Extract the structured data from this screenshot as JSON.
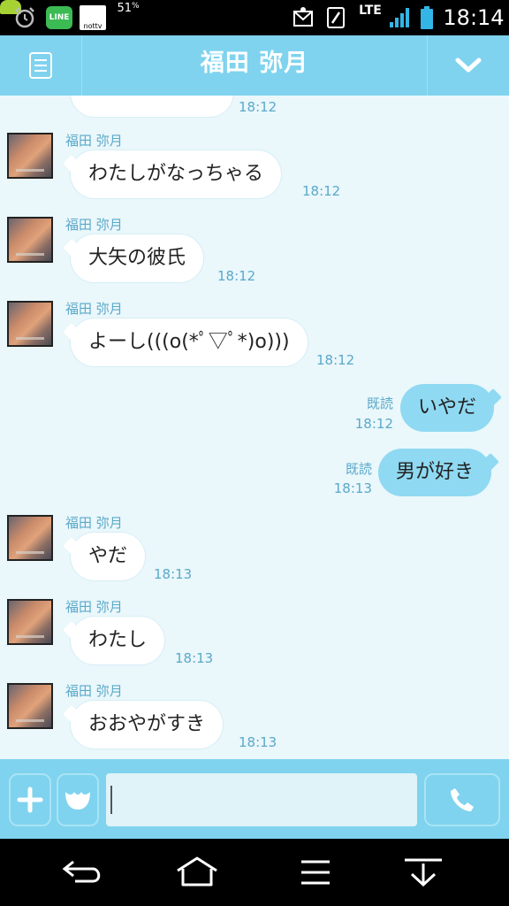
{
  "status_bar": {
    "line_label": "LINE",
    "nottv_label": "nottv",
    "percent": "51",
    "network": "LTE",
    "time": "18:14"
  },
  "header": {
    "title": "福田 弥月"
  },
  "messages": [
    {
      "direction": "in",
      "sender": "",
      "text": "",
      "time": "18:12"
    },
    {
      "direction": "in",
      "sender": "福田 弥月",
      "text": "わたしがなっちゃる",
      "time": "18:12"
    },
    {
      "direction": "in",
      "sender": "福田 弥月",
      "text": "大矢の彼氏",
      "time": "18:12"
    },
    {
      "direction": "in",
      "sender": "福田 弥月",
      "text": "よーし(((o(*ﾟ▽ﾟ*)o)))",
      "time": "18:12"
    },
    {
      "direction": "out",
      "read": "既読",
      "text": "いやだ",
      "time": "18:12"
    },
    {
      "direction": "out",
      "read": "既読",
      "text": "男が好き",
      "time": "18:13"
    },
    {
      "direction": "in",
      "sender": "福田 弥月",
      "text": "やだ",
      "time": "18:13"
    },
    {
      "direction": "in",
      "sender": "福田 弥月",
      "text": "わたし",
      "time": "18:13"
    },
    {
      "direction": "in",
      "sender": "福田 弥月",
      "text": "おおやがすき",
      "time": "18:13"
    }
  ],
  "input": {
    "value": ""
  },
  "icons": {
    "alarm": "alarm-clock-icon",
    "menu": "menu-icon",
    "chevron": "chevron-down-icon",
    "plus": "plus-icon",
    "sticker": "sticker-icon",
    "call": "phone-icon",
    "back": "back-arrow-icon",
    "home": "home-icon",
    "recent": "recent-apps-icon",
    "hide": "hide-keyboard-icon"
  },
  "colors": {
    "accent": "#7fd3ee",
    "outgoing_bubble": "#8fd9f2",
    "meta_text": "#5aa9c9",
    "chat_bg": "#eaf7fb"
  }
}
